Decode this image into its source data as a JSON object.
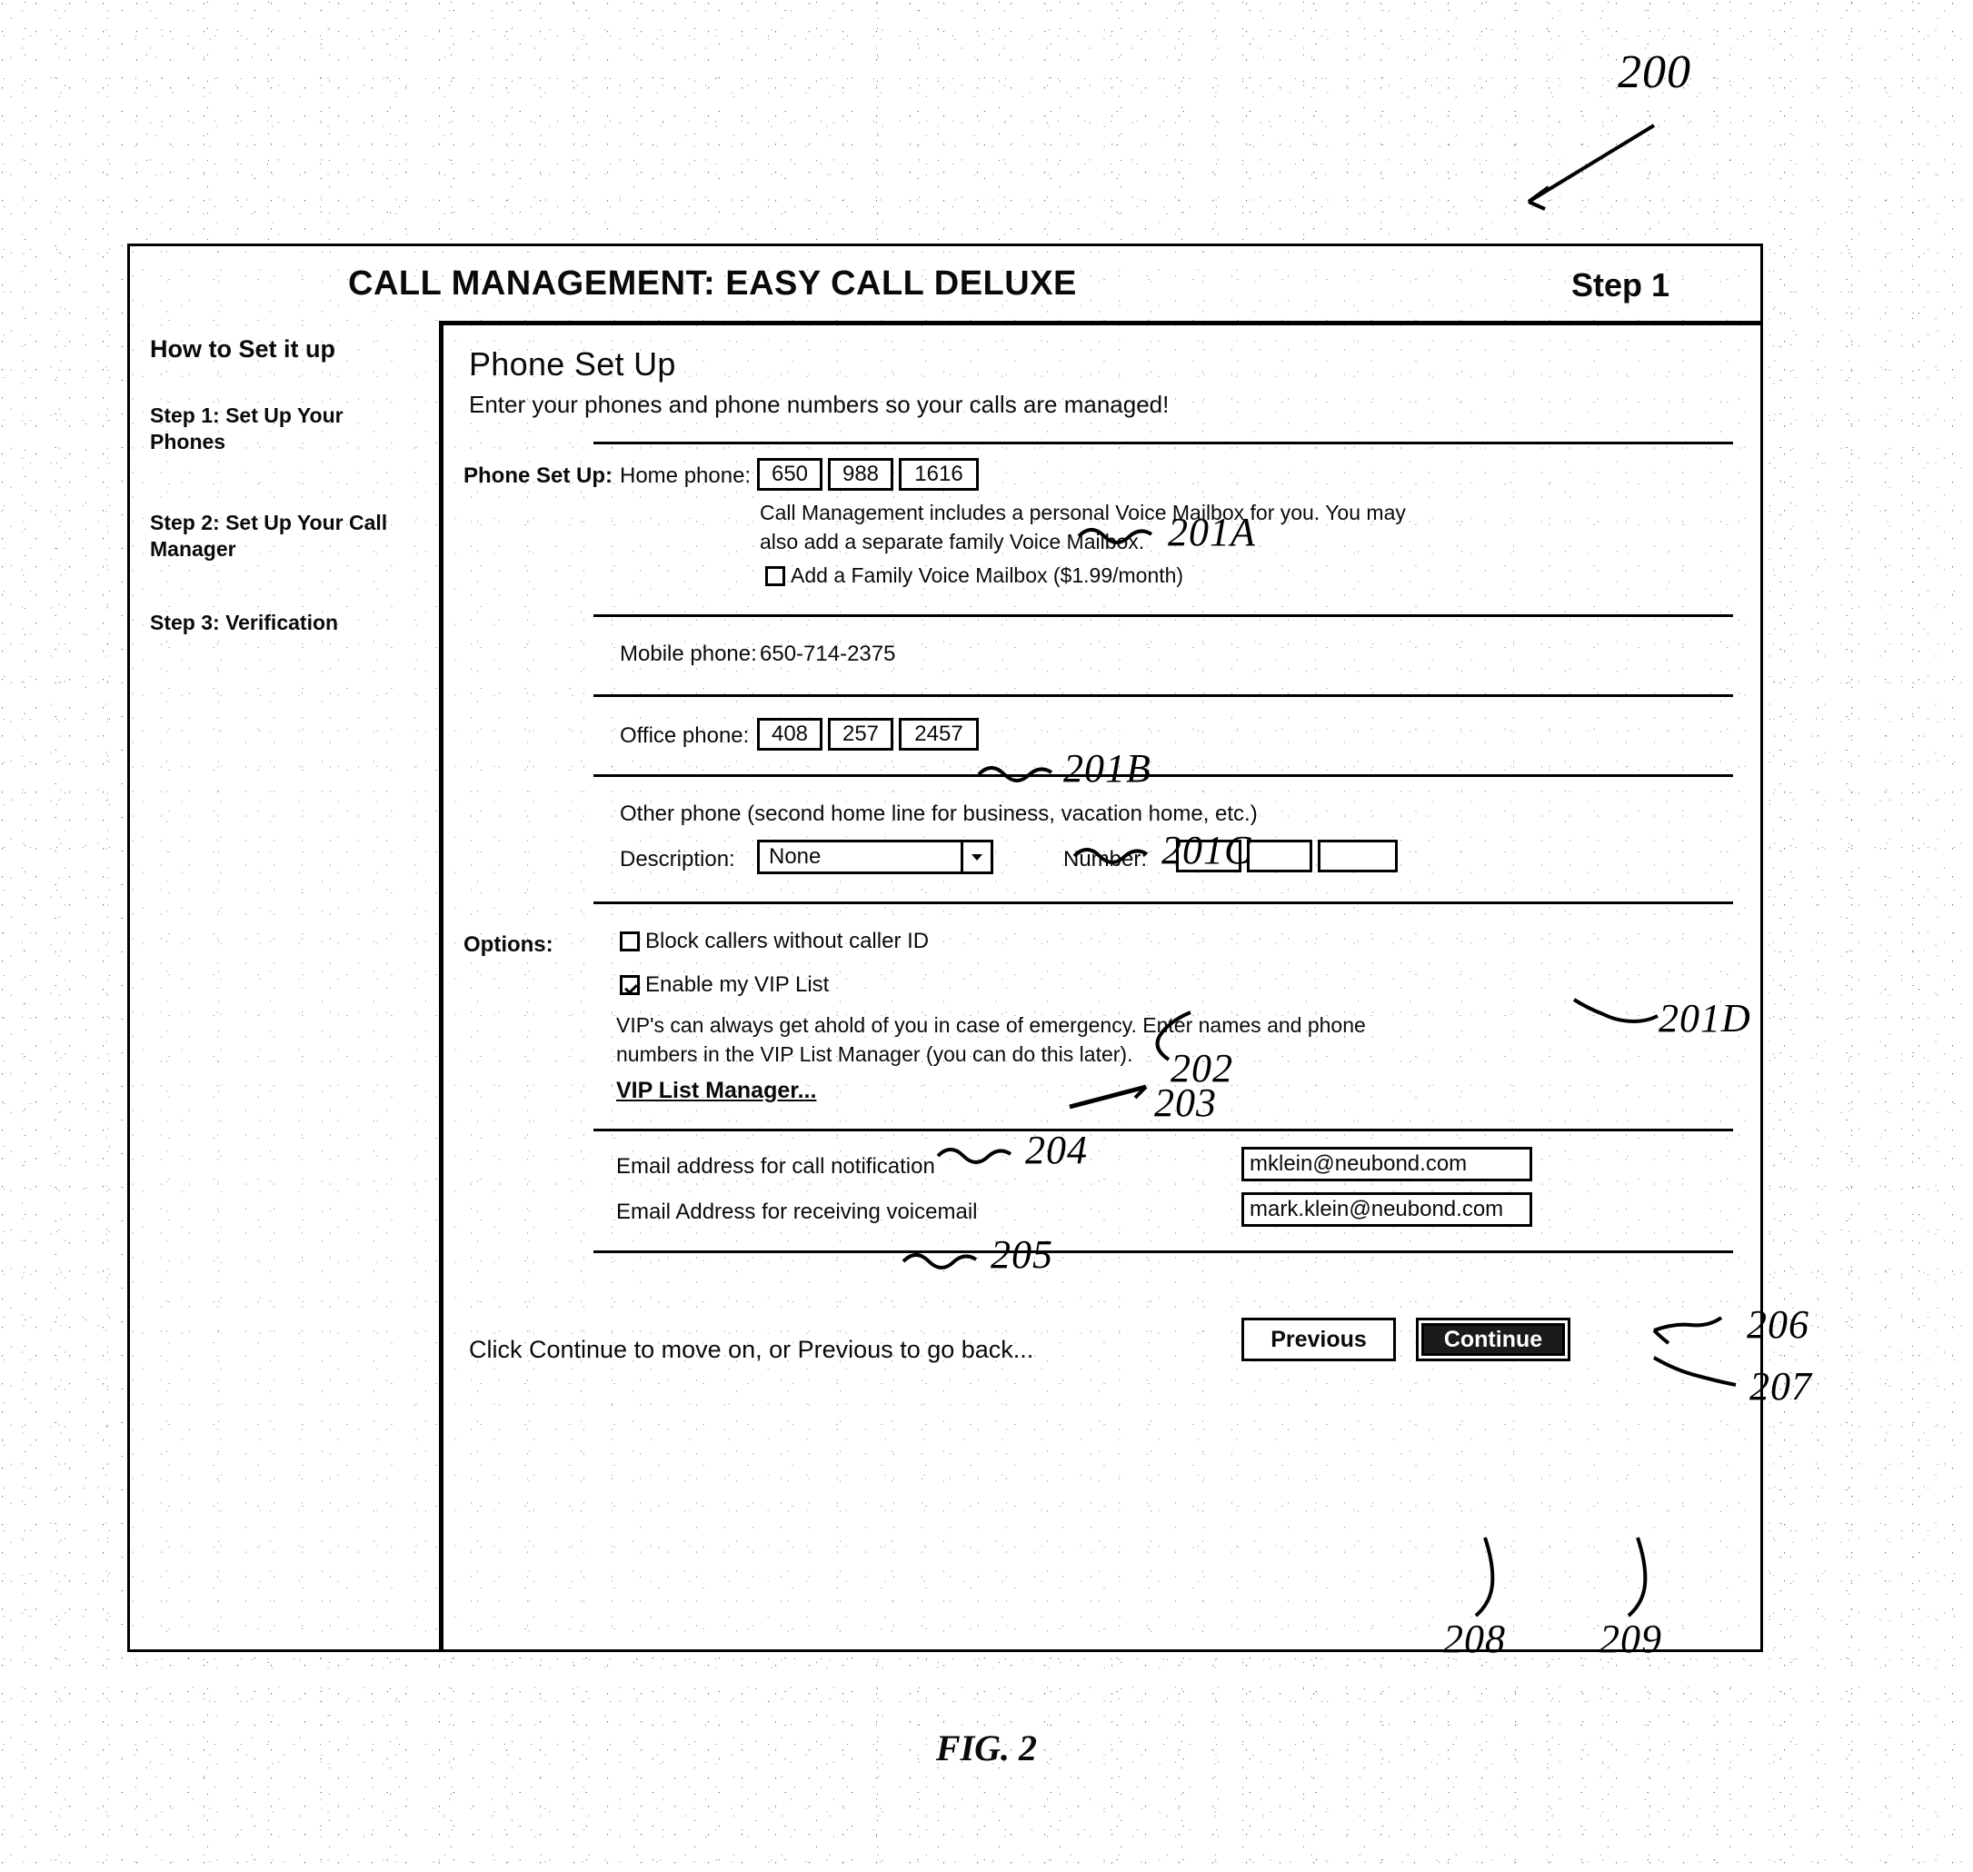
{
  "figure": {
    "caption": "FIG. 2",
    "reference_numerals": [
      {
        "id": "200",
        "label": "200"
      },
      {
        "id": "201A",
        "label": "201A"
      },
      {
        "id": "201B",
        "label": "201B"
      },
      {
        "id": "201C",
        "label": "201C"
      },
      {
        "id": "201D",
        "label": "201D"
      },
      {
        "id": "202",
        "label": "202"
      },
      {
        "id": "203",
        "label": "203"
      },
      {
        "id": "204",
        "label": "204"
      },
      {
        "id": "205",
        "label": "205"
      },
      {
        "id": "206",
        "label": "206"
      },
      {
        "id": "207",
        "label": "207"
      },
      {
        "id": "208",
        "label": "208"
      },
      {
        "id": "209",
        "label": "209"
      }
    ]
  },
  "header": {
    "title": "CALL MANAGEMENT: EASY CALL DELUXE",
    "step": "Step 1"
  },
  "sidebar": {
    "heading": "How to Set it up",
    "items": [
      {
        "label": "Step 1: Set Up Your Phones"
      },
      {
        "label": "Step 2: Set Up Your Call Manager"
      },
      {
        "label": "Step 3: Verification"
      }
    ]
  },
  "panel": {
    "title": "Phone Set Up",
    "subtitle": "Enter your phones and phone numbers so your calls are managed!"
  },
  "phone_setup": {
    "section_label": "Phone Set Up:",
    "home": {
      "label": "Home phone:",
      "area": "650",
      "prefix": "988",
      "line": "1616",
      "note_line1": "Call Management includes a personal Voice Mailbox for you. You may",
      "note_line2": "also add a separate family Voice Mailbox.",
      "family_mailbox_label": "Add a Family Voice Mailbox ($1.99/month)",
      "family_mailbox_checked": false
    },
    "mobile": {
      "label": "Mobile phone:",
      "value": "650-714-2375"
    },
    "office": {
      "label": "Office phone:",
      "area": "408",
      "prefix": "257",
      "line": "2457"
    },
    "other": {
      "heading": "Other phone (second home line for business, vacation home, etc.)",
      "description_label": "Description:",
      "description_value": "None",
      "number_label": "Number:",
      "area": "",
      "prefix": "",
      "line": ""
    }
  },
  "options": {
    "section_label": "Options:",
    "block_callers": {
      "label": "Block callers without caller ID",
      "checked": false
    },
    "vip": {
      "label": "Enable my VIP List",
      "checked": true,
      "note_line1": "VIP's can always get ahold of you in case of emergency. Enter names and phone",
      "note_line2": "numbers in the VIP List Manager (you can do this later).",
      "manager_link": "VIP List Manager..."
    }
  },
  "email": {
    "notification_label": "Email address for call notification",
    "notification_value": "mklein@neubond.com",
    "voicemail_label": "Email Address for receiving voicemail",
    "voicemail_value": "mark.klein@neubond.com"
  },
  "footer": {
    "hint": "Click Continue to move on, or Previous to go back...",
    "previous_label": "Previous",
    "continue_label": "Continue"
  },
  "icons": {
    "dropdown": "chevron-down-icon"
  }
}
